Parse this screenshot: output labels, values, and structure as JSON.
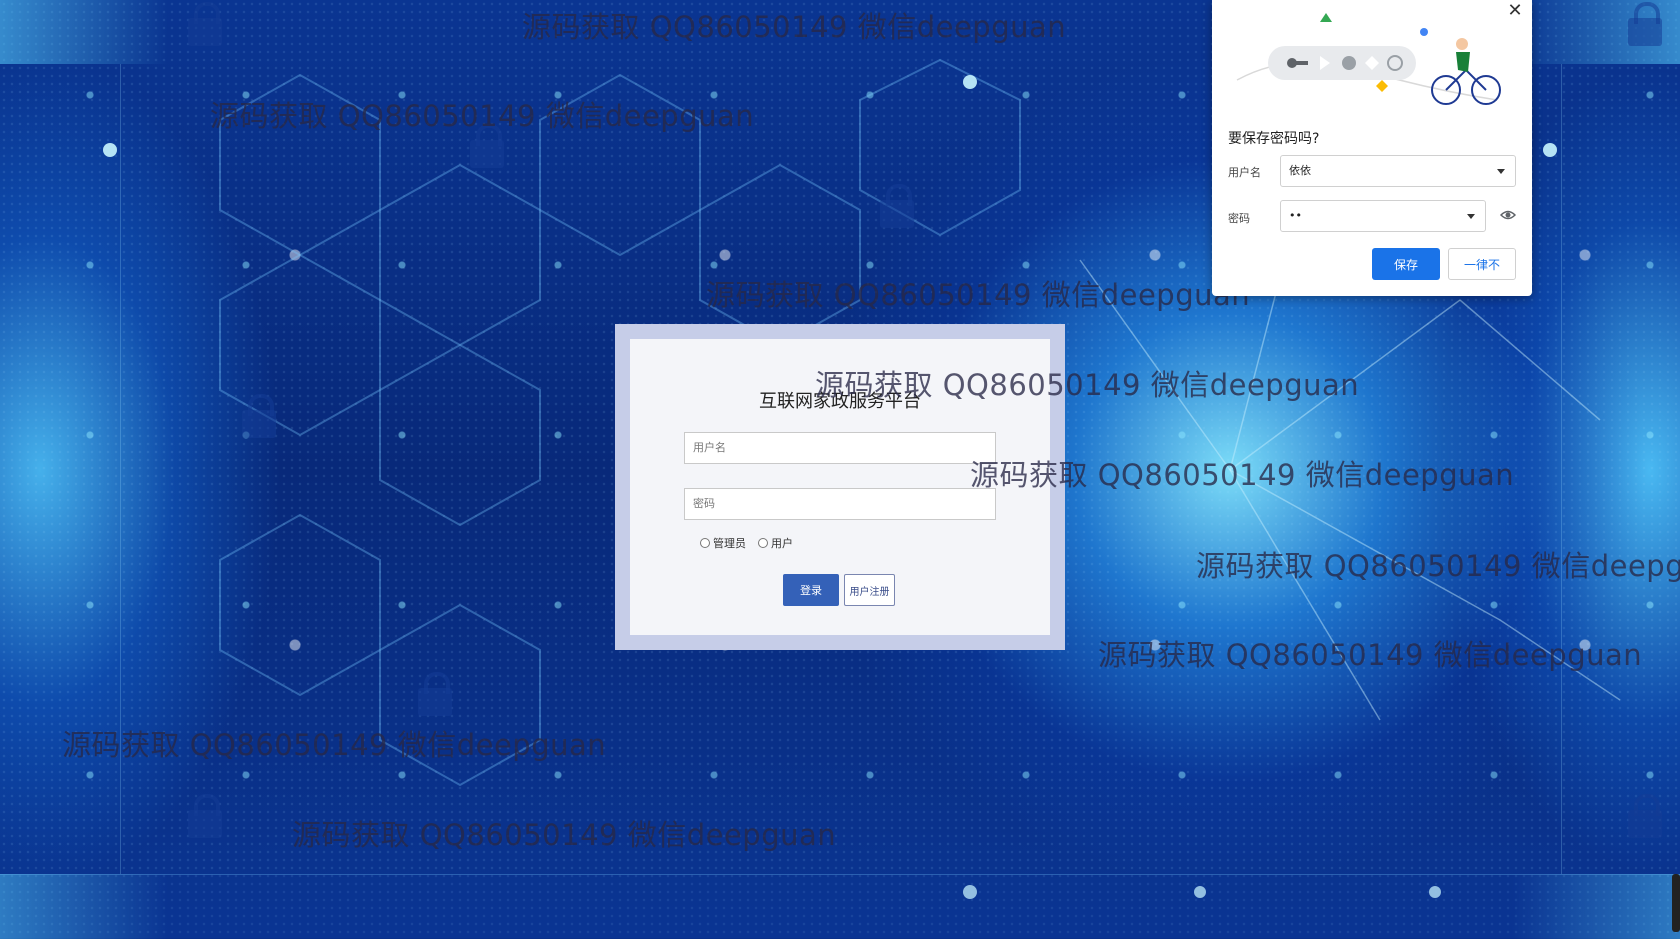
{
  "watermark_text": "源码获取 QQ86050149 微信deepguan",
  "login": {
    "title": "互联网家政服务平台",
    "username_placeholder": "用户名",
    "password_placeholder": "密码",
    "role_admin": "管理员",
    "role_user": "用户",
    "login_button": "登录",
    "register_button": "用户注册"
  },
  "password_popup": {
    "title": "要保存密码吗?",
    "username_label": "用户名",
    "username_value": "依依",
    "password_label": "密码",
    "password_value": "••",
    "save_button": "保存",
    "never_button": "一律不",
    "close_icon": "close-icon",
    "eye_icon": "eye-icon",
    "illustration": "key-and-cyclist-illustration"
  },
  "colors": {
    "background": "#0a2f86",
    "login_button": "#3461b8",
    "popup_save": "#1a73e8"
  }
}
